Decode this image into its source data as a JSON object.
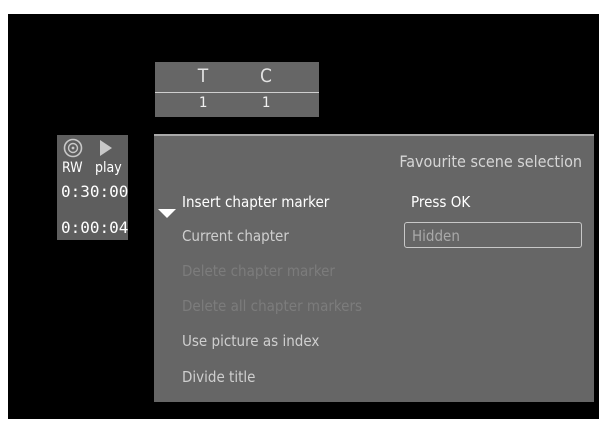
{
  "title_chapter": {
    "title_header": "T",
    "chapter_header": "C",
    "title_value": "1",
    "chapter_value": "1"
  },
  "status": {
    "disc_type": "RW",
    "play_state": "play",
    "total_time": "0:30:00",
    "elapsed_time": "0:00:04"
  },
  "menu": {
    "title": "Favourite scene selection",
    "items": [
      {
        "label": "Insert chapter marker",
        "state": "selected"
      },
      {
        "label": "Current chapter",
        "state": "enabled"
      },
      {
        "label": "Delete chapter marker",
        "state": "disabled"
      },
      {
        "label": "Delete all chapter markers",
        "state": "disabled"
      },
      {
        "label": "Use picture as index",
        "state": "enabled"
      },
      {
        "label": "Divide title",
        "state": "enabled"
      }
    ],
    "insert_action_text": "Press OK",
    "current_chapter_value": "Hidden"
  },
  "icons": {
    "disc": "disc-icon",
    "play": "play-icon",
    "selection": "down-triangle-icon"
  },
  "colors": {
    "screen_background": "#000000",
    "panel": "#666666",
    "selected_text": "#ffffff",
    "disabled_text": "#7c7c7c"
  }
}
